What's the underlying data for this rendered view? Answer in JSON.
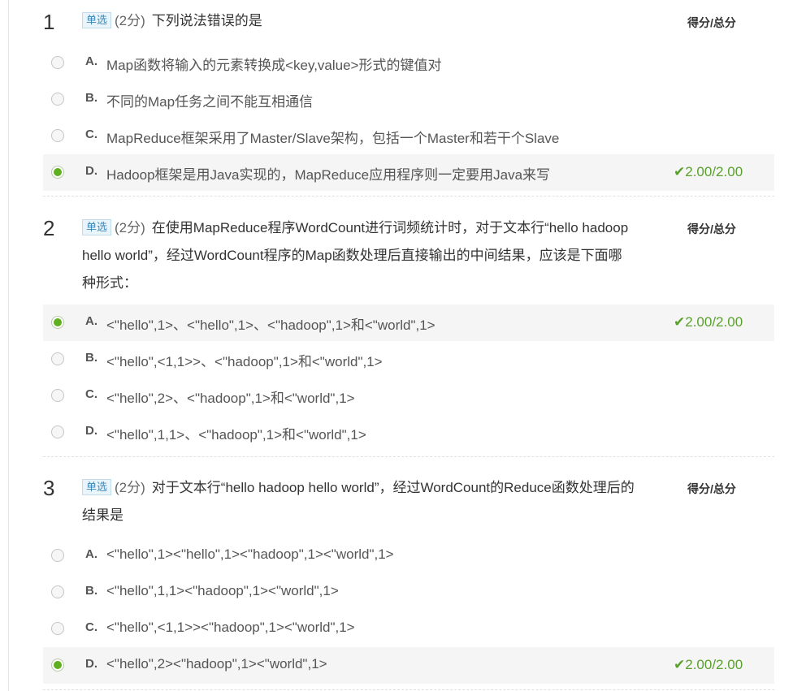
{
  "score_header": "得分/总分",
  "questions": [
    {
      "number": "1",
      "type": "单选",
      "points": "(2分)",
      "text": "下列说法错误的是",
      "options": [
        {
          "letter": "A.",
          "text": "Map函数将输入的元素转换成<key,value>形式的键值对",
          "selected": false,
          "result": ""
        },
        {
          "letter": "B.",
          "text": "不同的Map任务之间不能互相通信",
          "selected": false,
          "result": ""
        },
        {
          "letter": "C.",
          "text": "MapReduce框架采用了Master/Slave架构，包括一个Master和若干个Slave",
          "selected": false,
          "result": ""
        },
        {
          "letter": "D.",
          "text": "Hadoop框架是用Java实现的，MapReduce应用程序则一定要用Java来写",
          "selected": true,
          "result": "2.00/2.00"
        }
      ]
    },
    {
      "number": "2",
      "type": "单选",
      "points": "(2分)",
      "text": "在使用MapReduce程序WordCount进行词频统计时，对于文本行“hello hadoop hello world”，经过WordCount程序的Map函数处理后直接输出的中间结果，应该是下面哪种形式：",
      "options": [
        {
          "letter": "A.",
          "text": "<\"hello\",1>、<\"hello\",1>、<\"hadoop\",1>和<\"world\",1>",
          "selected": true,
          "result": "2.00/2.00"
        },
        {
          "letter": "B.",
          "text": "<\"hello\",<1,1>>、<\"hadoop\",1>和<\"world\",1>",
          "selected": false,
          "result": ""
        },
        {
          "letter": "C.",
          "text": "<\"hello\",2>、<\"hadoop\",1>和<\"world\",1>",
          "selected": false,
          "result": ""
        },
        {
          "letter": "D.",
          "text": "<\"hello\",1,1>、<\"hadoop\",1>和<\"world\",1>",
          "selected": false,
          "result": ""
        }
      ]
    },
    {
      "number": "3",
      "type": "单选",
      "points": "(2分)",
      "text": "对于文本行“hello hadoop hello world”，经过WordCount的Reduce函数处理后的结果是",
      "options": [
        {
          "letter": "A.",
          "text": "<\"hello\",1><\"hello\",1><\"hadoop\",1><\"world\",1>",
          "selected": false,
          "result": ""
        },
        {
          "letter": "B.",
          "text": "<\"hello\",1,1><\"hadoop\",1><\"world\",1>",
          "selected": false,
          "result": ""
        },
        {
          "letter": "C.",
          "text": "<\"hello\",<1,1>><\"hadoop\",1><\"world\",1>",
          "selected": false,
          "result": ""
        },
        {
          "letter": "D.",
          "text": "<\"hello\",2><\"hadoop\",1><\"world\",1>",
          "selected": true,
          "result": "2.00/2.00"
        }
      ]
    }
  ],
  "icons": {
    "check": "check-icon",
    "radio": "radio-icon"
  },
  "colors": {
    "correct": "#5aa02c",
    "radio_selected": "#5fb01e",
    "type_badge": "#3a88b9"
  }
}
